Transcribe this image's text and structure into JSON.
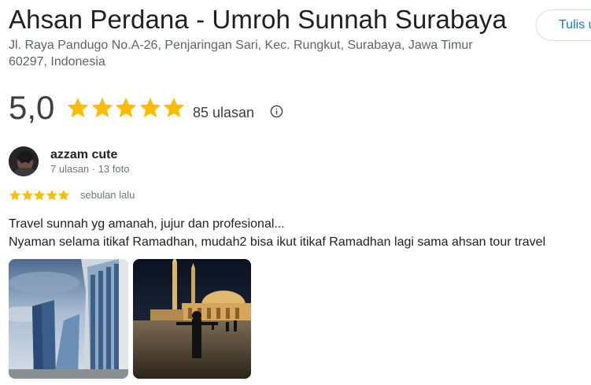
{
  "place": {
    "title": "Ahsan Perdana - Umroh Sunnah Surabaya",
    "address_line1": "Jl. Raya Pandugo No.A-26, Penjaringan Sari, Kec. Rungkut, Surabaya, Jawa Timur",
    "address_line2": "60297, Indonesia",
    "write_review_label": "Tulis ulasan"
  },
  "rating": {
    "score": "5,0",
    "stars": 5,
    "review_count": "85 ulasan",
    "info_icon": "info-icon",
    "star_color": "#fbbc04"
  },
  "review": {
    "reviewer_name": "azzam cute",
    "reviewer_meta": "7 ulasan · 13 foto",
    "stars": 5,
    "time": "sebulan lalu",
    "text_line1": "Travel sunnah yg amanah, jujur dan profesional...",
    "text_line2": "Nyaman selama itikaf Ramadhan, mudah2 bisa ikut itikaf Ramadhan lagi sama ahsan tour travel",
    "photos": [
      "photo-buildings",
      "photo-mosque-night"
    ]
  },
  "colors": {
    "accent": "#1a73e8",
    "text_primary": "#202124",
    "text_secondary": "#70757a"
  }
}
